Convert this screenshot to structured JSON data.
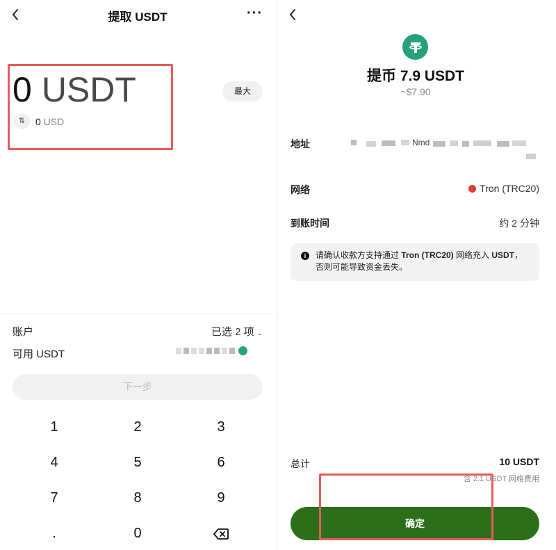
{
  "withdraw": {
    "title": "提取 USDT",
    "more": "···",
    "amount": "0",
    "amount_currency": "USDT",
    "max_label": "最大",
    "usd_value": "0",
    "usd_currency": "USD",
    "swap_icon": "swap-vertical-icon",
    "account_label": "账户",
    "account_value": "已选 2 项",
    "available_label": "可用 USDT",
    "next_label": "下一步",
    "keys": [
      "1",
      "2",
      "3",
      "4",
      "5",
      "6",
      "7",
      "8",
      "9",
      ".",
      "0"
    ],
    "backspace_icon": "backspace-icon"
  },
  "confirm": {
    "title": "提币 7.9 USDT",
    "subtitle": "~$7.90",
    "address_label": "地址",
    "address_visible_fragment": "Nmd",
    "network_label": "网络",
    "network_value": "Tron (TRC20)",
    "arrival_label": "到账时间",
    "arrival_value": "约 2 分钟",
    "notice_pre": "请确认收款方支持通过 ",
    "notice_network": "Tron (TRC20)",
    "notice_mid": " 网络充入 ",
    "notice_coin": "USDT",
    "notice_post": "，否则可能导致资金丢失。",
    "total_label": "总计",
    "total_value": "10 USDT",
    "fee_note": "含 2.1 USDT 网络费用",
    "confirm_label": "确定"
  },
  "colors": {
    "usdt_green": "#26a17b",
    "confirm_green": "#2c6e1a",
    "highlight_red": "#e85b5b",
    "tron_red": "#e63a36"
  }
}
